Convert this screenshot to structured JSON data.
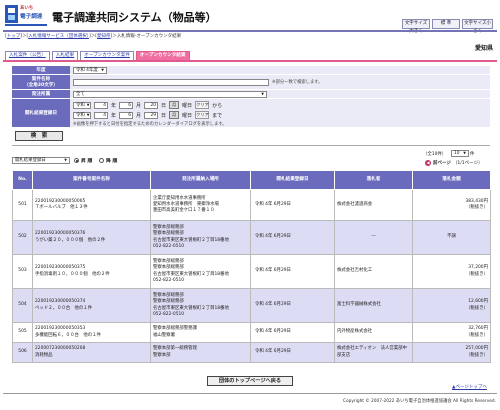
{
  "header": {
    "logo_line1": "あいち",
    "logo_line2": "電子調達",
    "title": "電子調達共同システム（物品等）",
    "font_large": "文字サイズ大きく",
    "font_standard": "標 準",
    "font_small": "文字サイズ小さく",
    "prefecture": "愛知県"
  },
  "breadcrumb": {
    "items": [
      "トップ",
      "入札情報サービス（団体選択）",
      "愛知県"
    ],
    "current": "入札情報-オープンカウンタ結果"
  },
  "tabs": [
    "入札案件（公告）",
    "入札結果",
    "オープンカウンタ案件",
    "オープンカウンタ結果"
  ],
  "form": {
    "year_label": "年度",
    "year_value": "令和 4年度",
    "case_name_label": "案件名称",
    "case_name_sub": "（全角30文字）",
    "case_name_note": "※部分一致で検索します。",
    "dept_label": "発注所属",
    "dept_value": "全て",
    "date_label": "開札結果登録日",
    "from": {
      "era": "令和",
      "year": "4",
      "year_u": "年",
      "month": "6",
      "month_u": "月",
      "day": "20",
      "day_u": "日",
      "cal": "月",
      "weekday": "曜日",
      "clear": "クリア",
      "suffix": "から"
    },
    "to": {
      "era": "令和",
      "year": "4",
      "year_u": "年",
      "month": "6",
      "month_u": "月",
      "day": "29",
      "day_u": "日",
      "cal": "月",
      "weekday": "曜日",
      "clear": "クリア",
      "suffix": "まで"
    },
    "date_note": "※画像を押下すると日付を指定するためのカレンダーダイアログを表示します。",
    "search_button": "検　索"
  },
  "controls": {
    "sort_value": "開札結果登録日",
    "asc_label": "昇 順",
    "desc_label": "降 順",
    "count_text": "（全10件）",
    "per_page": "10",
    "per_page_suffix": "件",
    "prev_label": "前ページ",
    "page_info": "（1/1ページ）"
  },
  "table": {
    "headers": {
      "no": "No.",
      "case_no": "案件番号",
      "case_name": "案件名称",
      "dept": "発注所属",
      "place": "納入場所",
      "date": "開札結果登録日",
      "winner": "落札者",
      "amount": "落札金額"
    },
    "rows": [
      {
        "no": "501",
        "case_no": "220019230000050065",
        "case_name": "Ｔボールバルブ　他１３件",
        "dept": [
          "企業庁愛知用水水道事務所",
          "愛知用水水道事務所　東郷浄水場",
          "豊田市高美町金ケ口１７番１０"
        ],
        "date": "令和  4年  6月29日",
        "winner": "株式会社濾過商会",
        "amount": "383,430円",
        "tax": "（税抜き）"
      },
      {
        "no": "502",
        "case_no": "220019230000050376",
        "case_name": "うがい薬２０，０００個　他の２件",
        "dept": [
          "警察本部総務部",
          "警察本部総務部",
          "名古屋市東区東大曽根町２丁目18番地",
          "052-822-0510"
        ],
        "date": "令和  4年  6月29日",
        "winner": "---",
        "amount": "不調",
        "tax": ""
      },
      {
        "no": "503",
        "case_no": "220019230000050375",
        "case_name": "手指消毒剤１０，０００個　他の２件",
        "dept": [
          "警察本部総務部",
          "警察本部総務部",
          "名古屋市東区東大曽根町２丁目18番地",
          "052-822-0510"
        ],
        "date": "令和  4年  6月29日",
        "winner": "株式会社吉村化工",
        "amount": "37,200円",
        "tax": "（税抜き）"
      },
      {
        "no": "504",
        "case_no": "220019230000050374",
        "case_name": "ベッド２，００台　他の１件",
        "dept": [
          "警察本部総務部",
          "警察本部総務部",
          "名古屋市東区東大曽根町２丁目18番地",
          "052-822-0510"
        ],
        "date": "令和  4年  6月29日",
        "winner": "富士科学器械株式会社",
        "amount": "12,600円",
        "tax": "（税抜き）"
      },
      {
        "no": "505",
        "case_no": "220019230000050353",
        "case_name": "多機能回転６，００台　他の１件",
        "dept": [
          "警察本部総務部警務課",
          "福山警察署"
        ],
        "date": "令和  4年  6月29日",
        "winner": "内外物産株式会社",
        "amount": "32,760円",
        "tax": "（税抜き）"
      },
      {
        "no": "506",
        "case_no": "220007230000050268",
        "case_name": "消耗物品",
        "dept": [
          "警察本部第一総務管理",
          "警察本部"
        ],
        "date": "令和  4年  6月29日",
        "winner": "株式会社エディオン　法人営業部中部支店",
        "amount": "257,000円",
        "tax": "（税抜き）"
      }
    ]
  },
  "footer": {
    "top_button": "団体のトップページへ戻る",
    "page_top": "▲ページトップへ",
    "copyright": "Copyright © 2007-2022 あいち電子自治体推進協議会 All Rights Reserved."
  }
}
